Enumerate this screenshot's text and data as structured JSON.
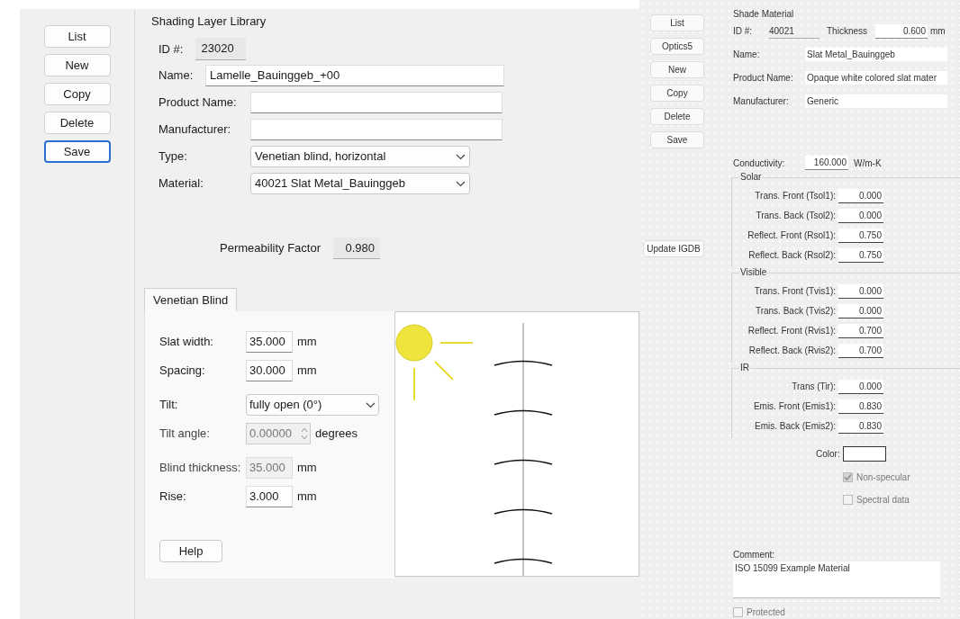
{
  "sidebar": {
    "buttons": [
      {
        "label": "List",
        "focused": false
      },
      {
        "label": "New",
        "focused": false
      },
      {
        "label": "Copy",
        "focused": false
      },
      {
        "label": "Delete",
        "focused": false
      },
      {
        "label": "Save",
        "focused": true
      }
    ]
  },
  "library": {
    "title": "Shading Layer Library",
    "id_label": "ID #:",
    "id_value": "23020",
    "fields": [
      {
        "label": "Name:",
        "value": "Lamelle_Bauinggeb_+00",
        "kind": "text"
      },
      {
        "label": "Product Name:",
        "kind": "text"
      },
      {
        "label": "Manufacturer:",
        "kind": "text"
      },
      {
        "label": "Type:",
        "value": "Venetian blind, horizontal",
        "kind": "dropdown"
      },
      {
        "label": "Material:",
        "value": "40021 Slat Metal_Bauinggeb",
        "kind": "dropdown"
      }
    ],
    "permeability": {
      "label": "Permeability Factor",
      "value": "0.980"
    }
  },
  "tabs": [
    {
      "label": "Venetian Blind",
      "selected": true
    }
  ],
  "blind_fields": [
    {
      "label": "Slat width:",
      "value": "35.000",
      "unit": "mm",
      "kind": "text",
      "disabled": false
    },
    {
      "label": "Spacing:",
      "value": "30.000",
      "unit": "mm",
      "kind": "text",
      "disabled": false
    },
    {
      "label": "Tilt:",
      "value": "fully open (0°)",
      "kind": "dropdown",
      "disabled": false
    },
    {
      "label": "Tilt angle:",
      "value": "0.00000",
      "unit": "degrees",
      "kind": "spinner",
      "disabled": true
    },
    {
      "label": "Blind thickness:",
      "value": "35.000",
      "unit": "mm",
      "kind": "text",
      "disabled": true
    },
    {
      "label": "Rise:",
      "value": "3.000",
      "unit": "mm",
      "kind": "text",
      "disabled": false
    }
  ],
  "help_button": "Help",
  "material": {
    "buttons": [
      "List",
      "Optics5",
      "New",
      "Copy",
      "Delete",
      "Save"
    ],
    "update_button": "Update IGDB",
    "title": "Shade Material",
    "id_label": "ID #:",
    "id_value": "40021",
    "thickness_label": "Thickness",
    "thickness_value": "0.600",
    "thickness_unit": "mm",
    "fields": [
      {
        "label": "Name:",
        "value": "Slat Metal_Bauinggeb"
      },
      {
        "label": "Product Name:",
        "value": "Opaque white colored slat mater"
      },
      {
        "label": "Manufacturer:",
        "value": "Generic"
      }
    ],
    "conductivity_label": "Conductivity:",
    "conductivity_value": "160.000",
    "conductivity_unit": "W/m-K",
    "groups": [
      {
        "title": "Solar",
        "rows": [
          {
            "label": "Trans. Front (Tsol1):",
            "value": "0.000"
          },
          {
            "label": "Trans. Back (Tsol2):",
            "value": "0.000"
          },
          {
            "label": "Reflect. Front (Rsol1):",
            "value": "0.750"
          },
          {
            "label": "Reflect. Back (Rsol2):",
            "value": "0.750"
          }
        ]
      },
      {
        "title": "Visible",
        "rows": [
          {
            "label": "Trans. Front (Tvis1):",
            "value": "0.000"
          },
          {
            "label": "Trans. Back (Tvis2):",
            "value": "0.000"
          },
          {
            "label": "Reflect. Front (Rvis1):",
            "value": "0.700"
          },
          {
            "label": "Reflect. Back (Rvis2):",
            "value": "0.700"
          }
        ]
      },
      {
        "title": "IR",
        "rows": [
          {
            "label": "Trans (Tir):",
            "value": "0.000"
          },
          {
            "label": "Emis. Front (Emis1):",
            "value": "0.830"
          },
          {
            "label": "Emis. Back (Emis2):",
            "value": "0.830"
          }
        ]
      }
    ],
    "color_label": "Color:",
    "checks": [
      {
        "label": "Non-specular",
        "checked": true
      },
      {
        "label": "Spectral data",
        "checked": false
      }
    ],
    "comment_label": "Comment:",
    "comment": "ISO 15099 Example Material",
    "protected": {
      "label": "Protected",
      "checked": false
    }
  }
}
